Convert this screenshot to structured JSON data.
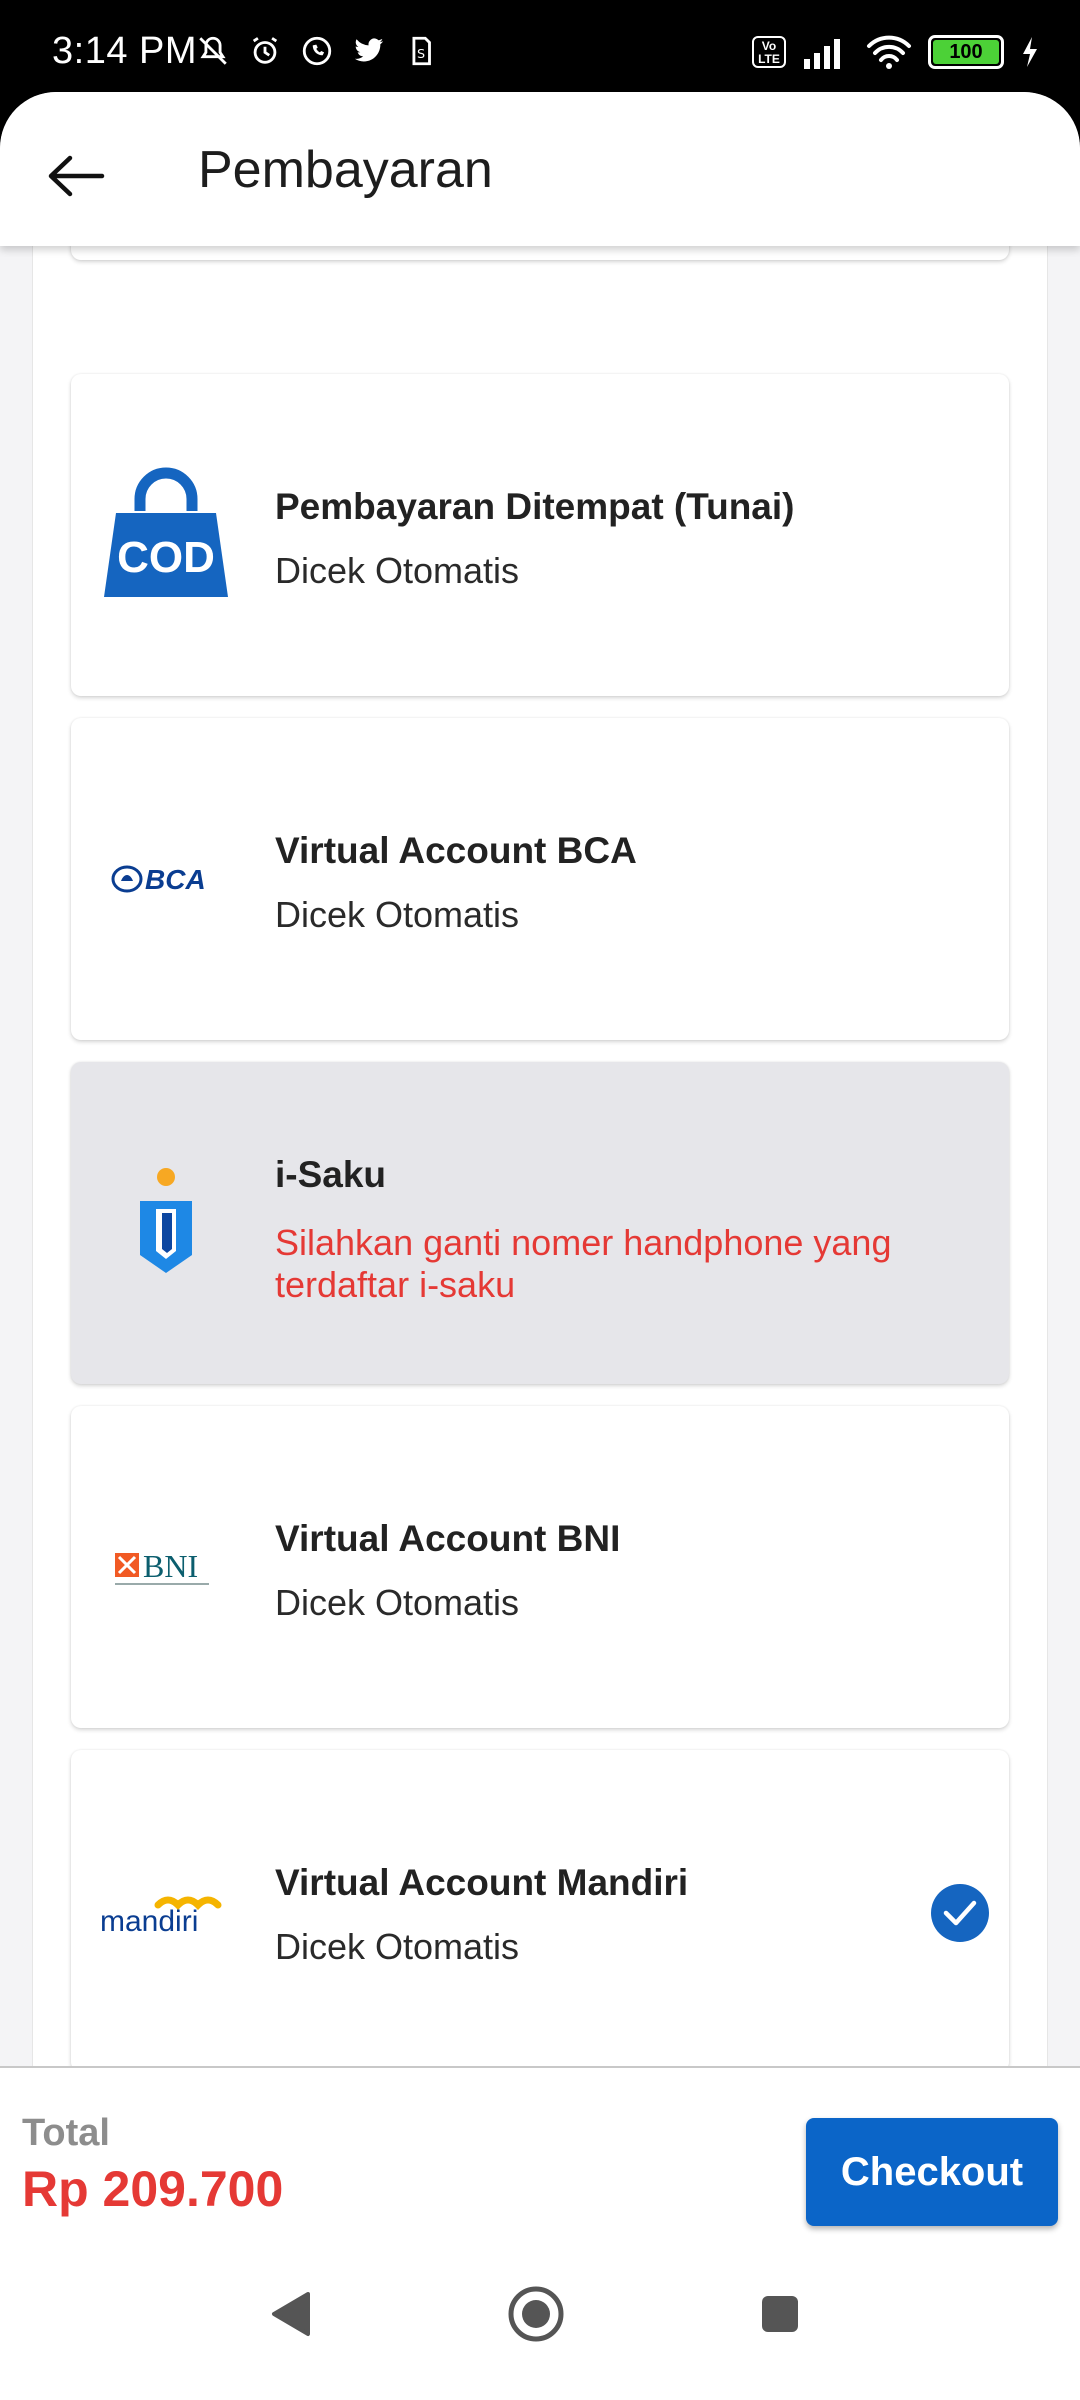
{
  "status_bar": {
    "time": "3:14 PM",
    "volte": "Vo LTE",
    "battery": "100",
    "icons": [
      "muted-bell-icon",
      "alarm-icon",
      "whatsapp-icon",
      "twitter-icon",
      "sim-icon",
      "signal-icon",
      "wifi-icon",
      "battery-icon",
      "charging-icon"
    ]
  },
  "header": {
    "title": "Pembayaran",
    "back_icon": "arrow-left-icon"
  },
  "payment_methods": [
    {
      "title": "Pembayaran Ditempat (Tunai)",
      "subtitle": "Dicek Otomatis",
      "logo": "COD",
      "disabled": false,
      "selected": false
    },
    {
      "title": "Virtual Account BCA",
      "subtitle": "Dicek Otomatis",
      "logo": "BCA",
      "disabled": false,
      "selected": false
    },
    {
      "title": "i-Saku",
      "subtitle": "Silahkan ganti nomer handphone yang terdaftar i-saku",
      "logo": "i-saku",
      "disabled": true,
      "selected": false
    },
    {
      "title": "Virtual Account BNI",
      "subtitle": "Dicek Otomatis",
      "logo": "BNI",
      "disabled": false,
      "selected": false
    },
    {
      "title": "Virtual Account Mandiri",
      "subtitle": "Dicek Otomatis",
      "logo": "mandiri",
      "disabled": false,
      "selected": true
    }
  ],
  "footer": {
    "total_label": "Total",
    "total_value": "Rp 209.700",
    "checkout_label": "Checkout"
  },
  "colors": {
    "primary": "#0b65c8",
    "price": "#e53935",
    "disabled_card": "#e6e6ea"
  }
}
